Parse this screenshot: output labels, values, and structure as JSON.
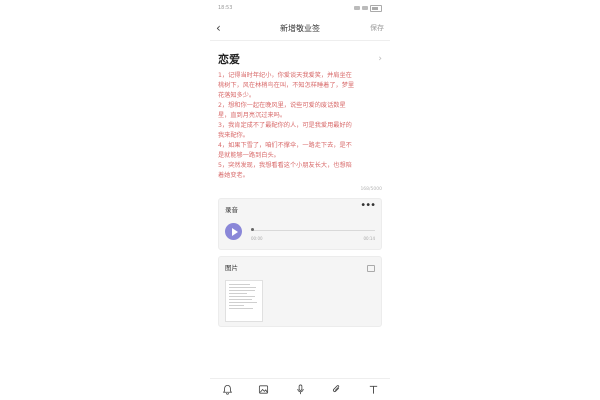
{
  "status_bar": {
    "time": "18:53"
  },
  "nav": {
    "title": "新增敬业签",
    "save_label": "保存"
  },
  "note": {
    "title": "恋爱",
    "lines": [
      "1，记得当时年纪小，你爱谈天我爱笑，并肩坐在",
      "桃树下，风在林梢鸟在叫，不知怎样睡着了，梦里",
      "花落知多少。",
      "2，想和你一起在晚风里，说些可爱的废话数星",
      "星，直到月亮沉过来吗。",
      "3，我肯定成不了最配你的人，可是我爱用最好的",
      "我来配你。",
      "4，如果下雪了，咱们不撑伞，一路走下去，是不",
      "是就能够一路到白头。",
      "5，突然发现，我想看看这个小朋友长大，也想陪",
      "着她变老。"
    ],
    "word_count": "168/5000"
  },
  "recording": {
    "title": "录音",
    "time_current": "00:00",
    "time_total": "00:14",
    "progress": 0
  },
  "image_section": {
    "title": "图片"
  },
  "colors": {
    "accent": "#8a87d8",
    "note_text": "#d86a6a"
  }
}
